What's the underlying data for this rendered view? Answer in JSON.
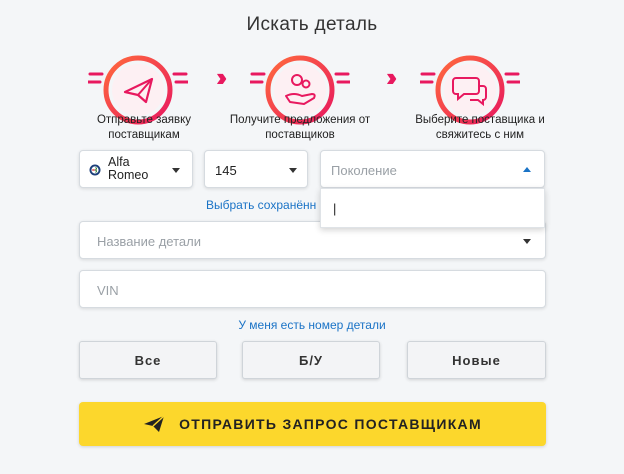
{
  "page": {
    "title": "Искать деталь"
  },
  "steps": [
    {
      "icon": "paper-plane-icon",
      "caption": "Отправьте заявку поставщикам"
    },
    {
      "icon": "gears-hand-icon",
      "caption": "Получите предложения от поставщиков"
    },
    {
      "icon": "chat-bubbles-icon",
      "caption": "Выберите поставщика и свяжитесь с ним"
    }
  ],
  "filters": {
    "brand": {
      "label": "Alfa Romeo"
    },
    "model": {
      "value": "145"
    },
    "generation": {
      "placeholder": "Поколение",
      "cursor_text": "|"
    }
  },
  "saved_link": "Выбрать сохранённ",
  "part_name": {
    "placeholder": "Название детали"
  },
  "vin": {
    "placeholder": "VIN"
  },
  "part_number_link": "У меня есть номер детали",
  "condition": {
    "options": [
      "Все",
      "Б/У",
      "Новые"
    ]
  },
  "submit": {
    "label": "ОТПРАВИТЬ ЗАПРОС ПОСТАВЩИКАМ"
  },
  "colors": {
    "accent": "#e8195f",
    "link": "#1a73c6",
    "submit_bg": "#fcd72c"
  }
}
